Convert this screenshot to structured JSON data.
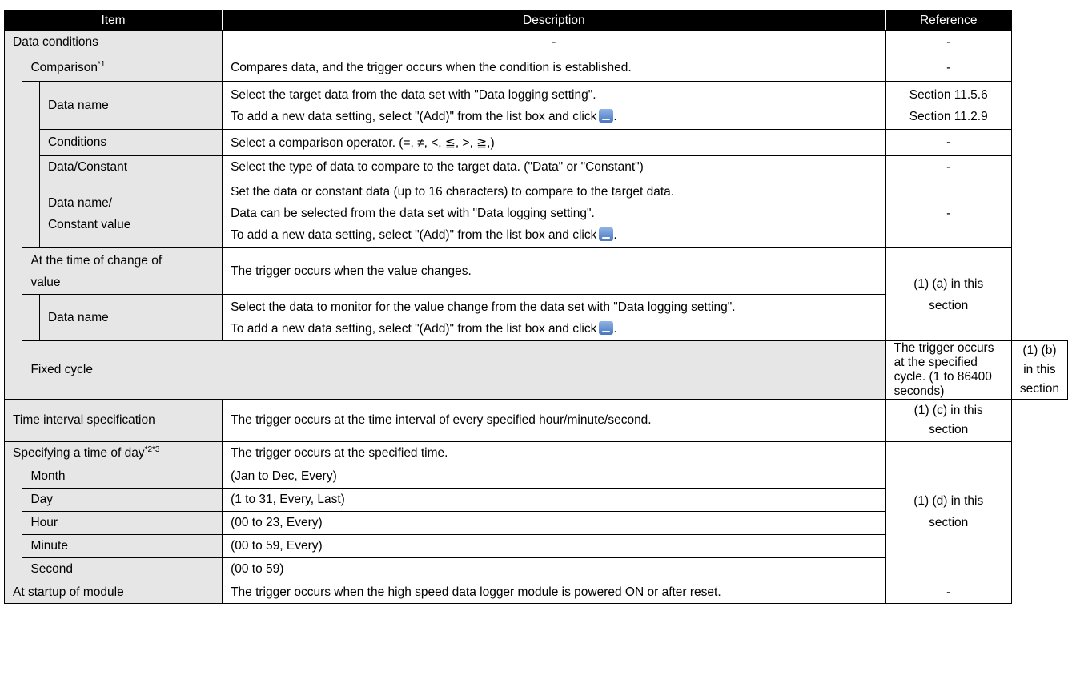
{
  "headers": {
    "item": "Item",
    "description": "Description",
    "reference": "Reference"
  },
  "rows": {
    "data_conditions": {
      "item": "Data conditions",
      "desc": "-",
      "ref": "-"
    },
    "comparison": {
      "item": "Comparison",
      "sup": "*1",
      "desc": "Compares data, and the trigger occurs when the condition is established.",
      "ref": "-"
    },
    "cmp_data_name": {
      "item": "Data name",
      "desc1": "Select the target data from the data set with \"Data logging setting\".",
      "desc2": "To add a new data setting, select \"(Add)\" from the list box and click",
      "desc2_end": ".",
      "ref1": "Section 11.5.6",
      "ref2": "Section 11.2.9"
    },
    "conditions": {
      "item": "Conditions",
      "desc": "Select a comparison operator. (=, ≠, <, ≦, >, ≧,)",
      "ref": "-"
    },
    "data_constant": {
      "item": "Data/Constant",
      "desc": "Select the type of data to compare to the target data. (\"Data\" or \"Constant\")",
      "ref": "-"
    },
    "constant_value": {
      "item1": "Data name/",
      "item2": "Constant value",
      "desc1": "Set the data or constant data (up to 16 characters) to compare to the target data.",
      "desc2": "Data can be selected from the data set with \"Data logging setting\".",
      "desc3": "To add a new data setting, select \"(Add)\" from the list box and click",
      "desc3_end": ".",
      "ref": "-"
    },
    "change_of_value": {
      "item1": "At the time of change of",
      "item2": "value",
      "desc": "The trigger occurs when the value changes.",
      "ref1": "(1) (a) in this",
      "ref2": "section"
    },
    "cov_data_name": {
      "item": "Data name",
      "desc1": "Select the data to monitor for the value change from the data set with \"Data logging setting\".",
      "desc2": "To add a new data setting, select \"(Add)\" from the list box and click",
      "desc2_end": "."
    },
    "fixed_cycle": {
      "item": "Fixed cycle",
      "desc": "The trigger occurs at the specified cycle. (1 to 86400 seconds)",
      "ref1": "(1) (b) in this",
      "ref2": "section"
    },
    "time_interval": {
      "item": "Time interval specification",
      "desc": "The trigger occurs at the time interval of every specified hour/minute/second.",
      "ref1": "(1) (c) in this",
      "ref2": "section"
    },
    "time_of_day": {
      "item": "Specifying a time of day",
      "sup": "*2*3",
      "desc": "The trigger occurs at the specified time.",
      "ref1": "(1) (d) in this",
      "ref2": "section"
    },
    "month": {
      "item": "Month",
      "desc": "(Jan to Dec, Every)"
    },
    "day": {
      "item": "Day",
      "desc": "(1 to 31, Every, Last)"
    },
    "hour": {
      "item": "Hour",
      "desc": "(00 to 23, Every)"
    },
    "minute": {
      "item": "Minute",
      "desc": "(00 to 59, Every)"
    },
    "second": {
      "item": "Second",
      "desc": "(00 to 59)"
    },
    "startup": {
      "item": "At startup of module",
      "desc": "The trigger occurs when the high speed data logger module is powered ON or after reset.",
      "ref": "-"
    }
  },
  "icons": {
    "browse_button": "browse-button-icon"
  }
}
